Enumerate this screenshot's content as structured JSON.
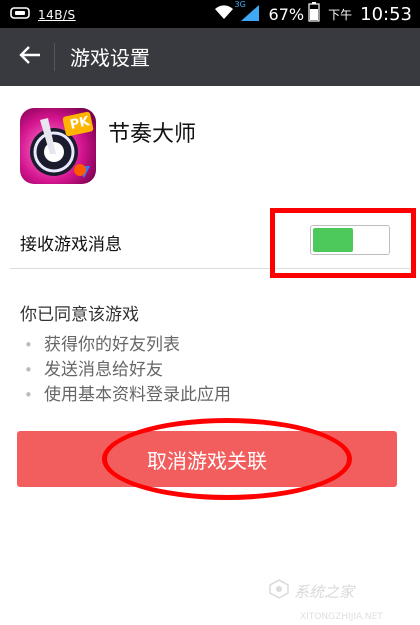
{
  "status_bar": {
    "network_speed": "14B/S",
    "battery_percent": "67%",
    "am_pm": "下午",
    "time": "10:53",
    "signal_type": "3G"
  },
  "header": {
    "title": "游戏设置"
  },
  "game": {
    "name": "节奏大师",
    "icon_badge": "PK"
  },
  "notification_setting": {
    "label": "接收游戏消息",
    "enabled": true
  },
  "permissions": {
    "title": "你已同意该游戏",
    "items": [
      "获得你的好友列表",
      "发送消息给好友",
      "使用基本资料登录此应用"
    ]
  },
  "actions": {
    "unlink_label": "取消游戏关联"
  },
  "watermark": {
    "text": "系统之家",
    "url": "XITONGZHIJIA.NET"
  },
  "colors": {
    "app_bar": "#393a3f",
    "toggle_on": "#4cc95a",
    "danger_button": "#f25e5e",
    "annotation": "#ff0000"
  }
}
